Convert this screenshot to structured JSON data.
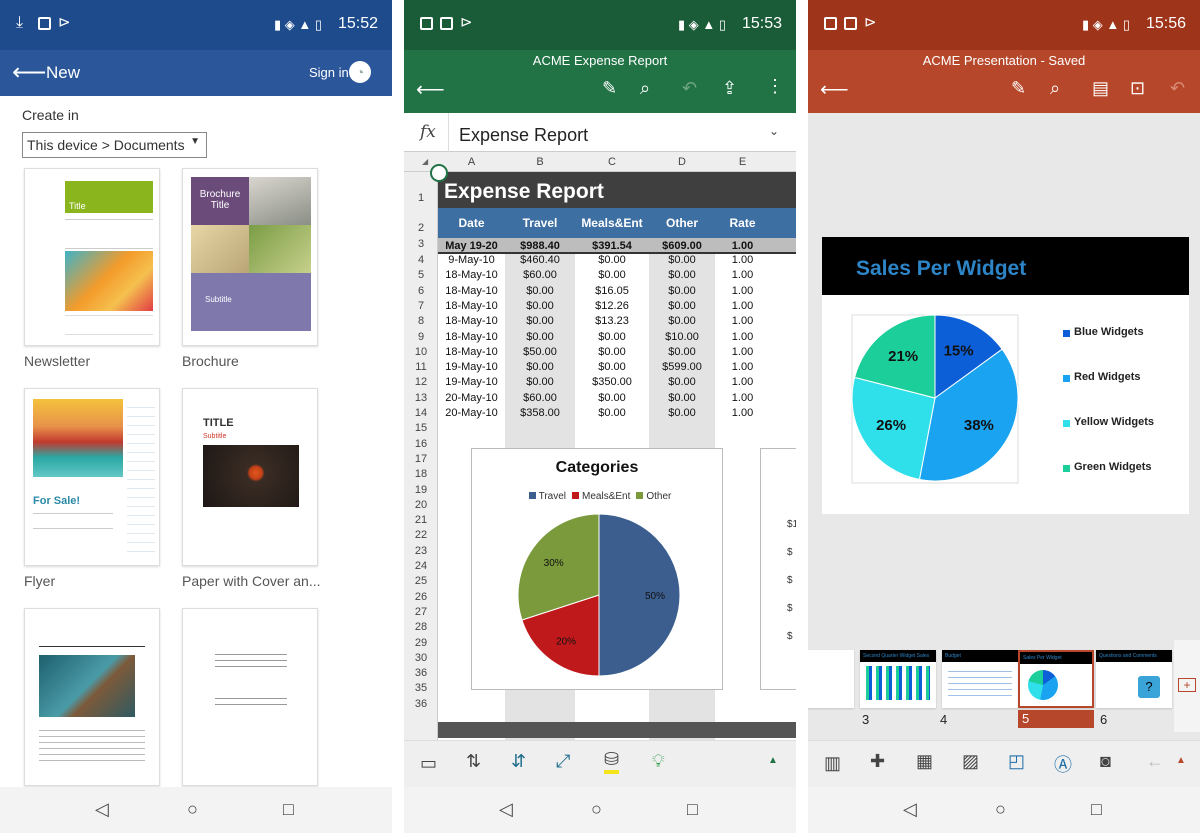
{
  "status": {
    "word_time": "15:52",
    "excel_time": "15:53",
    "ppt_time": "15:56"
  },
  "word": {
    "title": "New",
    "sign_in": "Sign in",
    "create_in": "Create in",
    "location": "This device > Documents",
    "templates": [
      {
        "name": "Newsletter"
      },
      {
        "name": "Brochure"
      },
      {
        "name": "Flyer"
      },
      {
        "name": "Paper with Cover an..."
      }
    ],
    "newsletter_title": "Title",
    "brochure_title": "Brochure Title",
    "brochure_subtitle": "Subtitle",
    "flyer_heading": "For Sale!",
    "paper_title": "TITLE",
    "paper_subtitle": "Subtitle"
  },
  "excel": {
    "doc_title": "ACME Expense Report",
    "formula_icon": "fx",
    "formula_value": "Expense Report",
    "columns": [
      "A",
      "B",
      "C",
      "D",
      "E"
    ],
    "sheet_title": "Expense Report",
    "headers": [
      "Date",
      "Travel",
      "Meals&Ent",
      "Other",
      "Rate"
    ],
    "total_row": [
      "May 19-20",
      "$988.40",
      "$391.54",
      "$609.00",
      "1.00"
    ],
    "rows": [
      [
        "9-May-10",
        "$460.40",
        "$0.00",
        "$0.00",
        "1.00"
      ],
      [
        "18-May-10",
        "$60.00",
        "$0.00",
        "$0.00",
        "1.00"
      ],
      [
        "18-May-10",
        "$0.00",
        "$16.05",
        "$0.00",
        "1.00"
      ],
      [
        "18-May-10",
        "$0.00",
        "$12.26",
        "$0.00",
        "1.00"
      ],
      [
        "18-May-10",
        "$0.00",
        "$13.23",
        "$0.00",
        "1.00"
      ],
      [
        "18-May-10",
        "$0.00",
        "$0.00",
        "$10.00",
        "1.00"
      ],
      [
        "18-May-10",
        "$50.00",
        "$0.00",
        "$0.00",
        "1.00"
      ],
      [
        "19-May-10",
        "$0.00",
        "$0.00",
        "$599.00",
        "1.00"
      ],
      [
        "19-May-10",
        "$0.00",
        "$350.00",
        "$0.00",
        "1.00"
      ],
      [
        "20-May-10",
        "$60.00",
        "$0.00",
        "$0.00",
        "1.00"
      ],
      [
        "20-May-10",
        "$358.00",
        "$0.00",
        "$0.00",
        "1.00"
      ]
    ],
    "row_numbers": [
      "1",
      "2",
      "3",
      "4",
      "5",
      "6",
      "7",
      "8",
      "9",
      "10",
      "11",
      "12",
      "13",
      "14",
      "15",
      "16",
      "17",
      "18",
      "19",
      "20",
      "21",
      "22",
      "23",
      "24",
      "25",
      "26",
      "27",
      "28",
      "29",
      "30",
      "36",
      "35",
      "36"
    ],
    "side_values": [
      "$1",
      "$",
      "$",
      "$",
      "$"
    ]
  },
  "ppt": {
    "doc_title": "ACME Presentation - Saved",
    "slide_title": "Sales Per Widget",
    "slide_numbers": [
      "3",
      "4",
      "5",
      "6"
    ],
    "thumb_titles": [
      "Second Quarter Widget Sales",
      "Budget",
      "Sales Per Widget",
      "Questions and Comments"
    ]
  },
  "chart_data": [
    {
      "type": "pie",
      "title": "Categories",
      "categories": [
        "Travel",
        "Meals&Ent",
        "Other"
      ],
      "values": [
        50,
        20,
        30
      ],
      "labels": [
        "50%",
        "20%",
        "30%"
      ],
      "colors": [
        "#3b5e8f",
        "#c0191c",
        "#7a9a3c"
      ],
      "legend": "top"
    },
    {
      "type": "pie",
      "title": "Sales Per Widget",
      "categories": [
        "Blue Widgets",
        "Red Widgets",
        "Yellow Widgets",
        "Green Widgets"
      ],
      "values": [
        15,
        38,
        26,
        21
      ],
      "labels": [
        "15%",
        "38%",
        "26%",
        "21%"
      ],
      "colors": [
        "#0d5fd8",
        "#19a3f0",
        "#2fe0ea",
        "#1ccf9a"
      ],
      "legend": "right"
    }
  ]
}
